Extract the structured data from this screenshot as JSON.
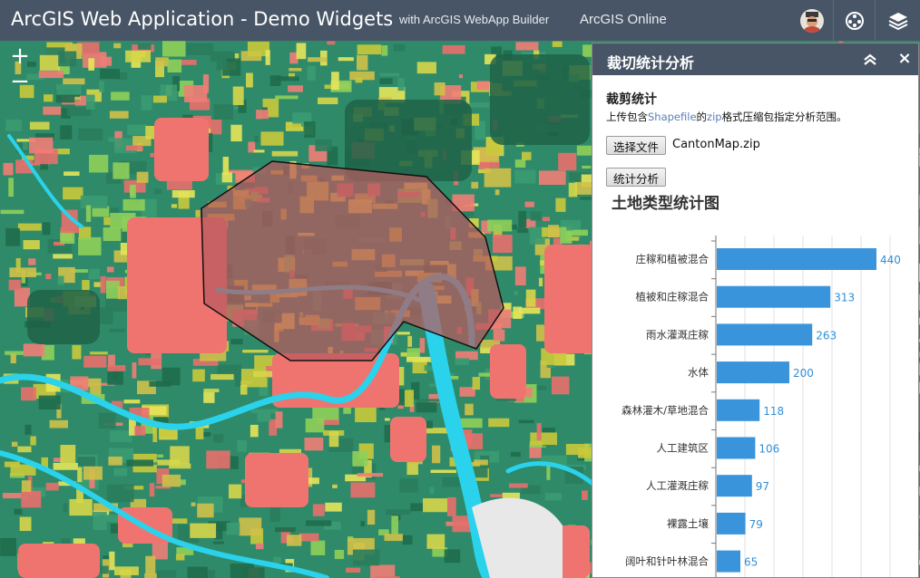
{
  "header": {
    "title": "ArcGIS Web Application - Demo Widgets",
    "subtitle": "with ArcGIS WebApp Builder",
    "online_link": "ArcGIS Online"
  },
  "header_icons": [
    "avatar-icon",
    "widget-icon",
    "layers-icon"
  ],
  "zoom": {
    "in": "+",
    "out": "−"
  },
  "panel": {
    "title": "裁切统计分析",
    "section_title": "裁剪统计",
    "desc_prefix": "上传包含",
    "desc_highlight1": "Shapefile",
    "desc_middle": "的",
    "desc_highlight2": "zip",
    "desc_suffix": "格式压缩包指定分析范围。",
    "file_button": "选择文件",
    "file_name": "CantonMap.zip",
    "analyze_button": "统计分析",
    "close_symbol": "×"
  },
  "colors": {
    "header_bg": "#485566",
    "bar": "#3a94dc",
    "value_label": "#2f8fd8",
    "polygon_fill": "#b85a5e",
    "water": "#2ad2ec"
  },
  "chart_data": {
    "type": "bar",
    "orientation": "horizontal",
    "title": "土地类型统计图",
    "categories": [
      "庄稼和植被混合",
      "植被和庄稼混合",
      "雨水灌溉庄稼",
      "水体",
      "森林灌木/草地混合",
      "人工建筑区",
      "人工灌溉庄稼",
      "裸露土壤",
      "阔叶和针叶林混合"
    ],
    "values": [
      440,
      313,
      263,
      200,
      118,
      106,
      97,
      79,
      65
    ],
    "xlim": [
      0,
      480
    ],
    "grid": true
  }
}
